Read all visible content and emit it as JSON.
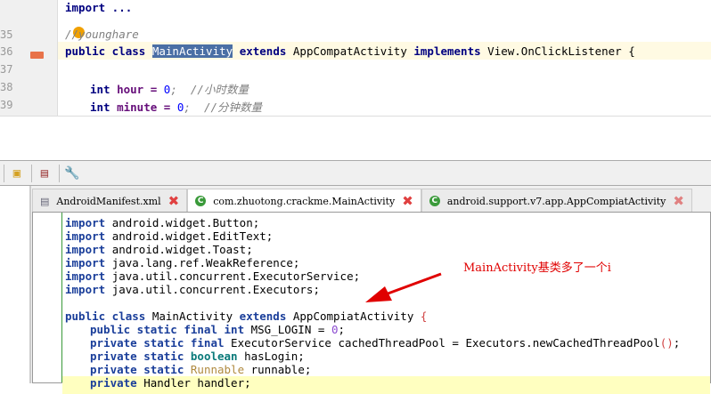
{
  "top_editor": {
    "line_numbers": [
      "35",
      "36",
      "37",
      "38",
      "39"
    ],
    "line0": "import ...",
    "comment": "//younghare",
    "class_kw": "public class",
    "class_name": "MainActivity",
    "extends_kw": "extends",
    "parent": "AppCompatActivity",
    "implements_kw": "implements",
    "iface": "View.OnClickListener {",
    "hour_type": "int",
    "hour_rest": " hour = ",
    "hour_val": "0",
    "hour_cmt": ";  //小时数量",
    "min_type": "int",
    "min_rest": " minute = ",
    "min_val": "0",
    "min_cmt": ";  //分钟数量"
  },
  "tabs": [
    {
      "label": "AndroidManifest.xml",
      "active": false
    },
    {
      "label": "com.zhuotong.crackme.MainActivity",
      "active": true
    },
    {
      "label": "android.support.v7.app.AppCompiatActivity",
      "active": false
    }
  ],
  "imports": [
    "android.widget.Button;",
    "android.widget.EditText;",
    "android.widget.Toast;",
    "java.lang.ref.WeakReference;",
    "java.util.concurrent.ExecutorService;",
    "java.util.concurrent.Executors;"
  ],
  "import_kw": "import",
  "code": {
    "l1a": "public class",
    "l1b": " MainActivity ",
    "l1c": "extends",
    "l1d": " AppCompiatActivity ",
    "l1e": "{",
    "l2a": "public static final int",
    "l2b": " MSG_LOGIN = ",
    "l2c": "0",
    "l2d": ";",
    "l3a": "private static final",
    "l3b": " ExecutorService cachedThreadPool = Executors.newCachedThreadPool",
    "l3c": "()",
    "l3d": ";",
    "l4a": "private static",
    "l4b": "boolean",
    "l4c": " hasLogin;",
    "l5a": "private static",
    "l5b": "Runnable",
    "l5c": " runnable;",
    "l6a": "private",
    "l6b": " Handler handler;"
  },
  "annotation": "MainActivity基类多了一个i"
}
